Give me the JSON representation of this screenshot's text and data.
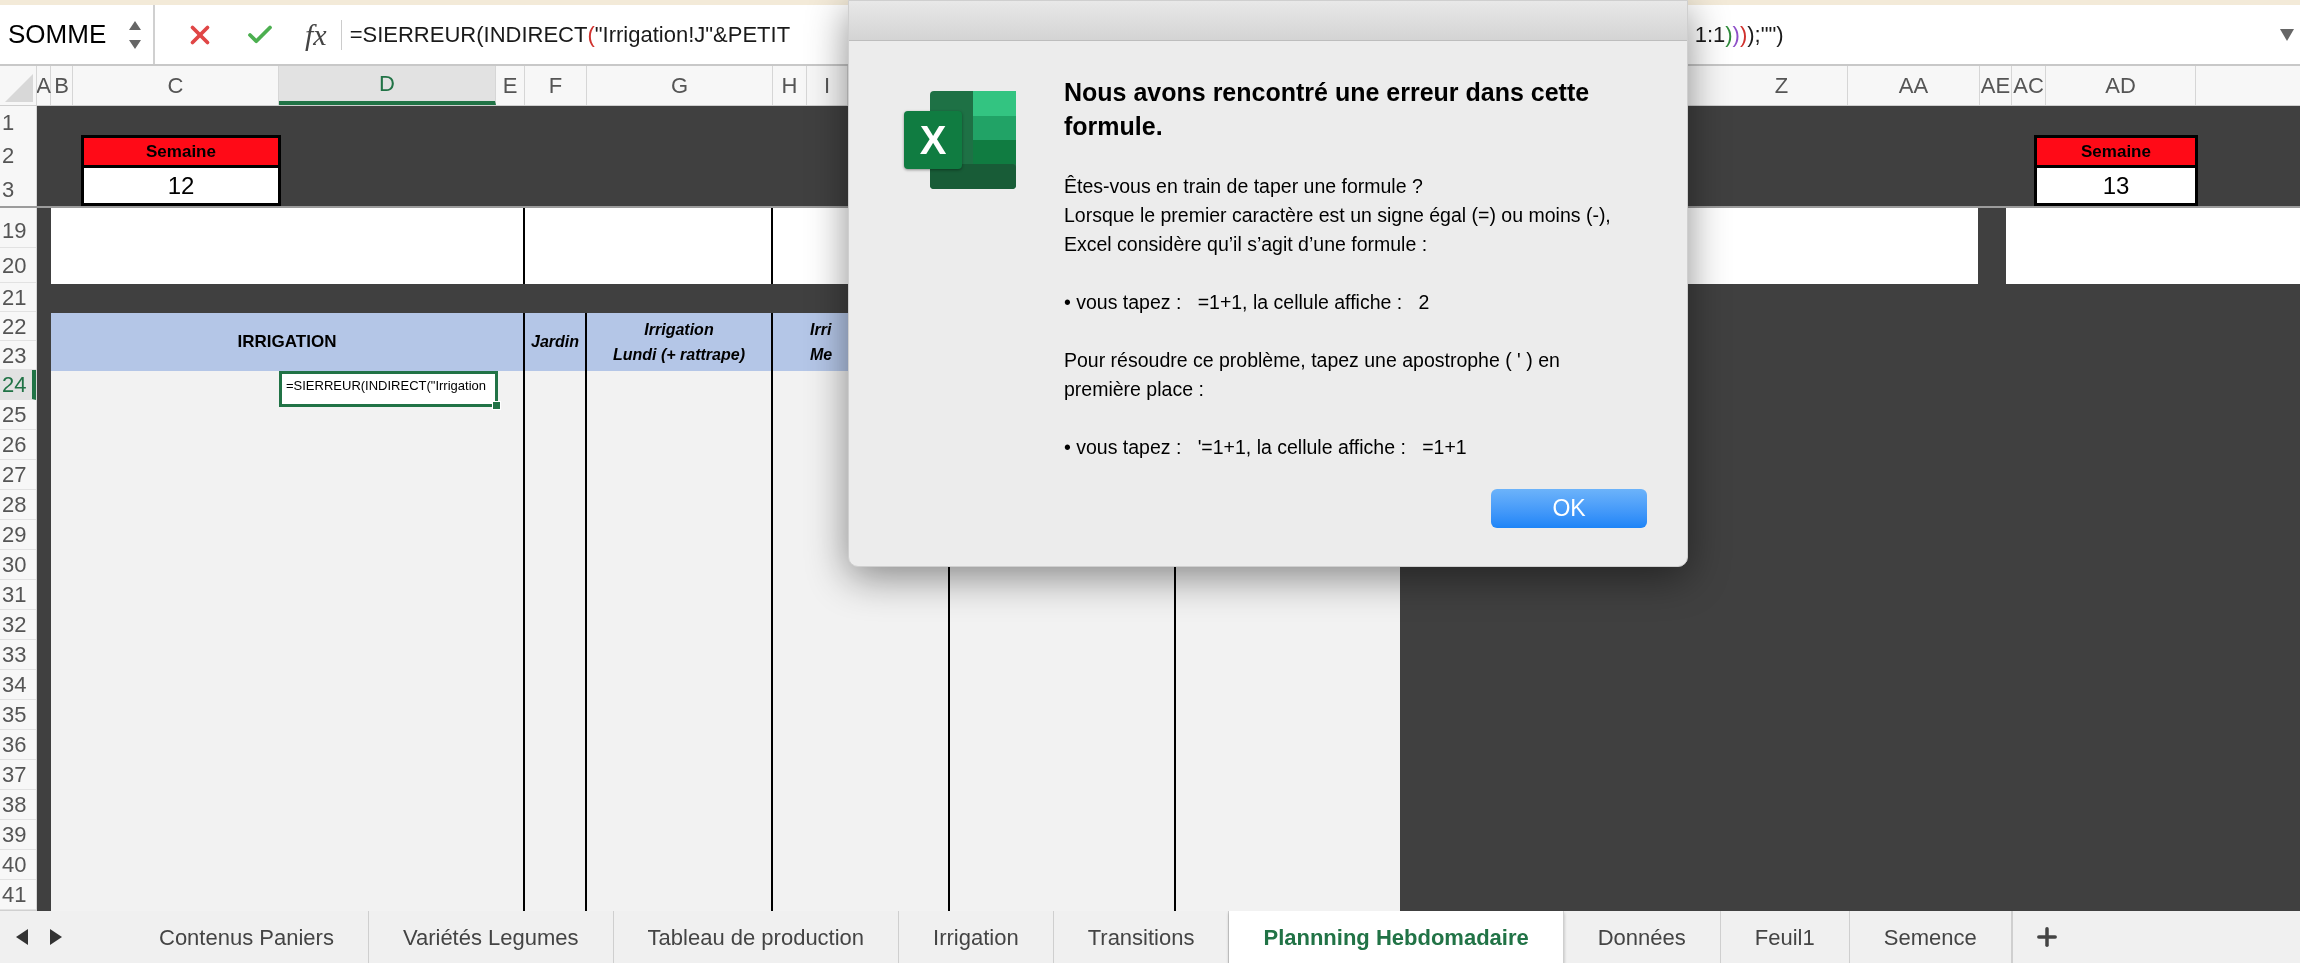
{
  "formula_bar": {
    "name_box": "SOMME",
    "fx": "fx",
    "formula_left": [
      {
        "text": "=SIERREUR(INDIRECT",
        "color": "#1a1a1a"
      },
      {
        "text": "(",
        "color": "#d0312d"
      },
      {
        "text": "\"Irrigation!J\"&PETIT",
        "color": "#1a1a1a"
      }
    ],
    "formula_right": [
      {
        "text": "1:1",
        "color": "#1a1a1a"
      },
      {
        "text": ")",
        "color": "#2e8b3a"
      },
      {
        "text": ")",
        "color": "#8e4fc8"
      },
      {
        "text": ")",
        "color": "#d0312d"
      },
      {
        "text": ");\"\")",
        "color": "#1a1a1a"
      }
    ]
  },
  "sheet": {
    "columns_left": [
      {
        "label": "A",
        "selected": false
      },
      {
        "label": "B",
        "selected": false
      },
      {
        "label": "C",
        "selected": false
      },
      {
        "label": "D",
        "selected": true
      },
      {
        "label": "E",
        "selected": false
      },
      {
        "label": "F",
        "selected": false
      },
      {
        "label": "G",
        "selected": false
      },
      {
        "label": "H",
        "selected": false
      },
      {
        "label": "I",
        "selected": false
      }
    ],
    "columns_right": [
      {
        "label": "Z",
        "selected": false
      },
      {
        "label": "AA",
        "selected": false
      },
      {
        "label": "AE",
        "selected": false
      },
      {
        "label": "AC",
        "selected": false
      },
      {
        "label": "AD",
        "selected": false
      }
    ],
    "frozen_rows": [
      {
        "number": "1",
        "selected": false
      },
      {
        "number": "2",
        "selected": false
      },
      {
        "number": "3",
        "selected": false
      }
    ],
    "week_boxes": [
      {
        "label": "Semaine",
        "value": "12"
      },
      {
        "label": "Semaine",
        "value": "13"
      }
    ],
    "rows": [
      {
        "number": "19",
        "kind": "band",
        "selected": false
      },
      {
        "number": "20",
        "kind": "band",
        "selected": false
      },
      {
        "number": "21",
        "kind": "spacer",
        "selected": false
      },
      {
        "number": "22",
        "kind": "header",
        "selected": false
      },
      {
        "number": "23",
        "kind": "header",
        "selected": false
      },
      {
        "number": "24",
        "kind": "data",
        "selected": true
      },
      {
        "number": "25",
        "kind": "data",
        "selected": false
      },
      {
        "number": "26",
        "kind": "data",
        "selected": false
      },
      {
        "number": "27",
        "kind": "data",
        "selected": false
      },
      {
        "number": "28",
        "kind": "data",
        "selected": false
      },
      {
        "number": "29",
        "kind": "data",
        "selected": false
      },
      {
        "number": "30",
        "kind": "data",
        "selected": false
      },
      {
        "number": "31",
        "kind": "data",
        "selected": false
      },
      {
        "number": "32",
        "kind": "data",
        "selected": false
      },
      {
        "number": "33",
        "kind": "data",
        "selected": false
      },
      {
        "number": "34",
        "kind": "data",
        "selected": false
      },
      {
        "number": "35",
        "kind": "data",
        "selected": false
      },
      {
        "number": "36",
        "kind": "data",
        "selected": false
      },
      {
        "number": "37",
        "kind": "data",
        "selected": false
      },
      {
        "number": "38",
        "kind": "data",
        "selected": false
      },
      {
        "number": "39",
        "kind": "data",
        "selected": false
      },
      {
        "number": "40",
        "kind": "data",
        "selected": false
      },
      {
        "number": "41",
        "kind": "data",
        "selected": false
      }
    ],
    "irrigation_header": {
      "title": "IRRIGATION",
      "jardin": "Jardin",
      "monday": [
        "Irrigation",
        "Lundi (+ rattrape)"
      ],
      "next": [
        "Irri",
        "Me"
      ]
    },
    "active_cell": {
      "value": "=SIERREUR(INDIRECT(\"Irrigation"
    }
  },
  "dialog": {
    "logo_letter": "X",
    "title": "Nous avons rencontré une erreur dans cette formule.",
    "paragraphs": [
      {
        "lines": [
          "Êtes-vous en train de taper une formule ?",
          "Lorsque le premier caractère est un signe égal (=) ou moins (-), Excel considère qu’il s’agit d’une formule :"
        ]
      },
      {
        "lines": [
          "• vous tapez :   =1+1, la cellule affiche :   2"
        ]
      },
      {
        "lines": [
          "Pour résoudre ce problème, tapez une apostrophe ( ' ) en première place :"
        ]
      },
      {
        "lines": [
          "• vous tapez :   '=1+1, la cellule affiche :   =1+1"
        ]
      }
    ],
    "button": "OK"
  },
  "sheet_tabs": [
    {
      "label": "Contenus Paniers",
      "selected": false
    },
    {
      "label": "Variétés Legumes",
      "selected": false
    },
    {
      "label": "Tableau de production",
      "selected": false
    },
    {
      "label": "Irrigation",
      "selected": false
    },
    {
      "label": "Transitions",
      "selected": false
    },
    {
      "label": "Plannning Hebdomadaire",
      "selected": true
    },
    {
      "label": "Données",
      "selected": false
    },
    {
      "label": "Feuil1",
      "selected": false
    },
    {
      "label": "Semence",
      "selected": false
    }
  ]
}
